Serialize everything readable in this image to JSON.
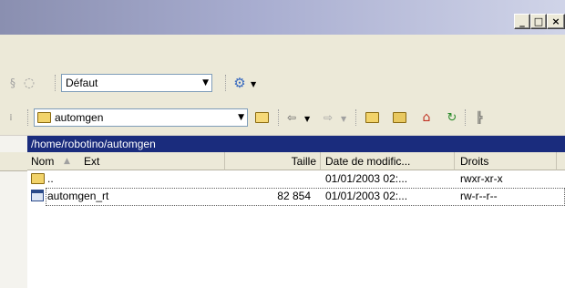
{
  "window": {
    "minimize_glyph": "_",
    "maximize_glyph": "□",
    "close_glyph": "×"
  },
  "toolbar1": {
    "profile_value": "Défaut"
  },
  "toolbar2": {
    "location_value": "automgen"
  },
  "path": "/home/robotino/automgen",
  "columns": {
    "name": "Nom",
    "ext": "Ext",
    "size": "Taille",
    "date": "Date de modific...",
    "rights": "Droits"
  },
  "files": [
    {
      "name": "..",
      "size": "",
      "date": "01/01/2003 02:...",
      "rights": "rwxr-xr-x",
      "icon": "parent-folder-icon"
    },
    {
      "name": "automgen_rt",
      "size": "82 854",
      "date": "01/01/2003 02:...",
      "rights": "rw-r--r--",
      "icon": "executable-file-icon"
    }
  ]
}
